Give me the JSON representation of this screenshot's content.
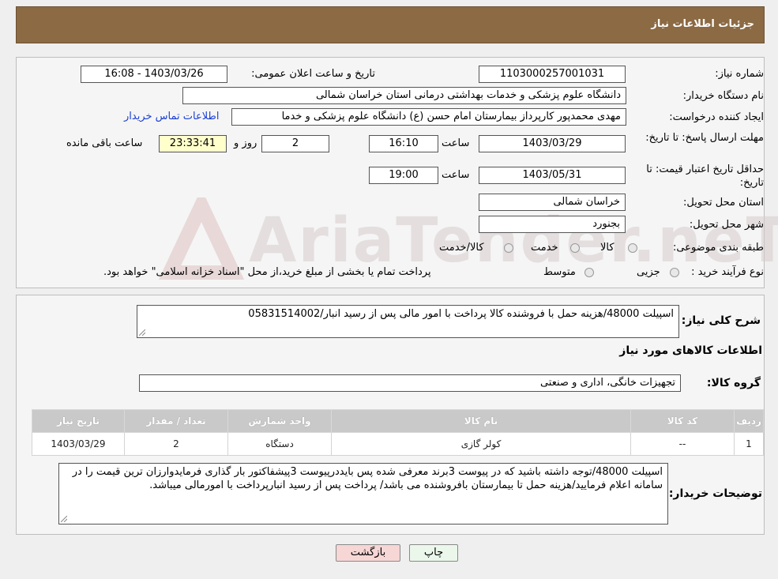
{
  "header": {
    "title": "جزئیات اطلاعات نیاز"
  },
  "fields": {
    "need_number_label": "شماره نیاز:",
    "need_number": "1103000257001031",
    "announce_label": "تاریخ و ساعت اعلان عمومی:",
    "announce_value": "1403/03/26 - 16:08",
    "buyer_org_label": "نام دستگاه خریدار:",
    "buyer_org": "دانشگاه علوم پزشکی و خدمات بهداشتی درمانی استان خراسان شمالی",
    "creator_label": "ایجاد کننده درخواست:",
    "creator": "مهدی محمدپور کارپرداز بیمارستان امام حسن (ع) دانشگاه علوم پزشکی و خدما",
    "contact_link": "اطلاعات تماس خریدار",
    "deadline_label": "مهلت ارسال پاسخ: تا تاریخ:",
    "deadline_date": "1403/03/29",
    "time_label": "ساعت",
    "deadline_time": "16:10",
    "days_value": "2",
    "days_label": "روز و",
    "remaining_time": "23:33:41",
    "remaining_label": "ساعت باقی مانده",
    "validity_label": "حداقل تاریخ اعتبار قیمت: تا تاریخ:",
    "validity_date": "1403/05/31",
    "validity_time": "19:00",
    "province_label": "استان محل تحویل:",
    "province": "خراسان شمالی",
    "city_label": "شهر محل تحویل:",
    "city": "بجنورد",
    "category_label": "طبقه بندی موضوعی:",
    "category_options": [
      "کالا",
      "خدمت",
      "کالا/خدمت"
    ],
    "process_label": "نوع فرآیند خرید :",
    "process_options": [
      "جزیی",
      "متوسط"
    ],
    "process_note": "پرداخت تمام یا بخشی از مبلغ خرید،از محل \"اسناد خزانه اسلامی\" خواهد بود."
  },
  "summary": {
    "label": "شرح کلی نیاز:",
    "text": "اسپیلت 48000/هزینه حمل با فروشنده کالا پرداخت با امور مالی پس از رسید انبار/05831514002"
  },
  "goods": {
    "section_title": "اطلاعات کالاهای مورد نیاز",
    "group_label": "گروه کالا:",
    "group_value": "تجهیزات خانگی، اداری و صنعتی",
    "columns": [
      "ردیف",
      "کد کالا",
      "نام کالا",
      "واحد شمارش",
      "تعداد / مقدار",
      "تاریخ نیاز"
    ],
    "rows": [
      [
        "1",
        "--",
        "کولر گازی",
        "دستگاه",
        "2",
        "1403/03/29"
      ]
    ]
  },
  "buyer_notes": {
    "label": "توضیحات خریدار:",
    "text": "اسپیلت 48000/توجه داشته باشید که در پیوست 3برند معرفی شده پس بایددرپیوست 3پیشفاکتور بار گذاری فرمایدوارزان ترین قیمت را در سامانه اعلام فرمایید/هزینه حمل تا بیمارستان بافروشنده می باشد/ پرداخت پس از رسید انبارپرداخت با امورمالی میباشد."
  },
  "buttons": {
    "print": "چاپ",
    "back": "بازگشت"
  },
  "colors": {
    "header_bg": "#8b6a44",
    "link": "#1a3fd6",
    "back_button_bg": "#f7d6d6",
    "print_button_bg": "#eaf7ea"
  },
  "watermark": "AriaTender.neT"
}
